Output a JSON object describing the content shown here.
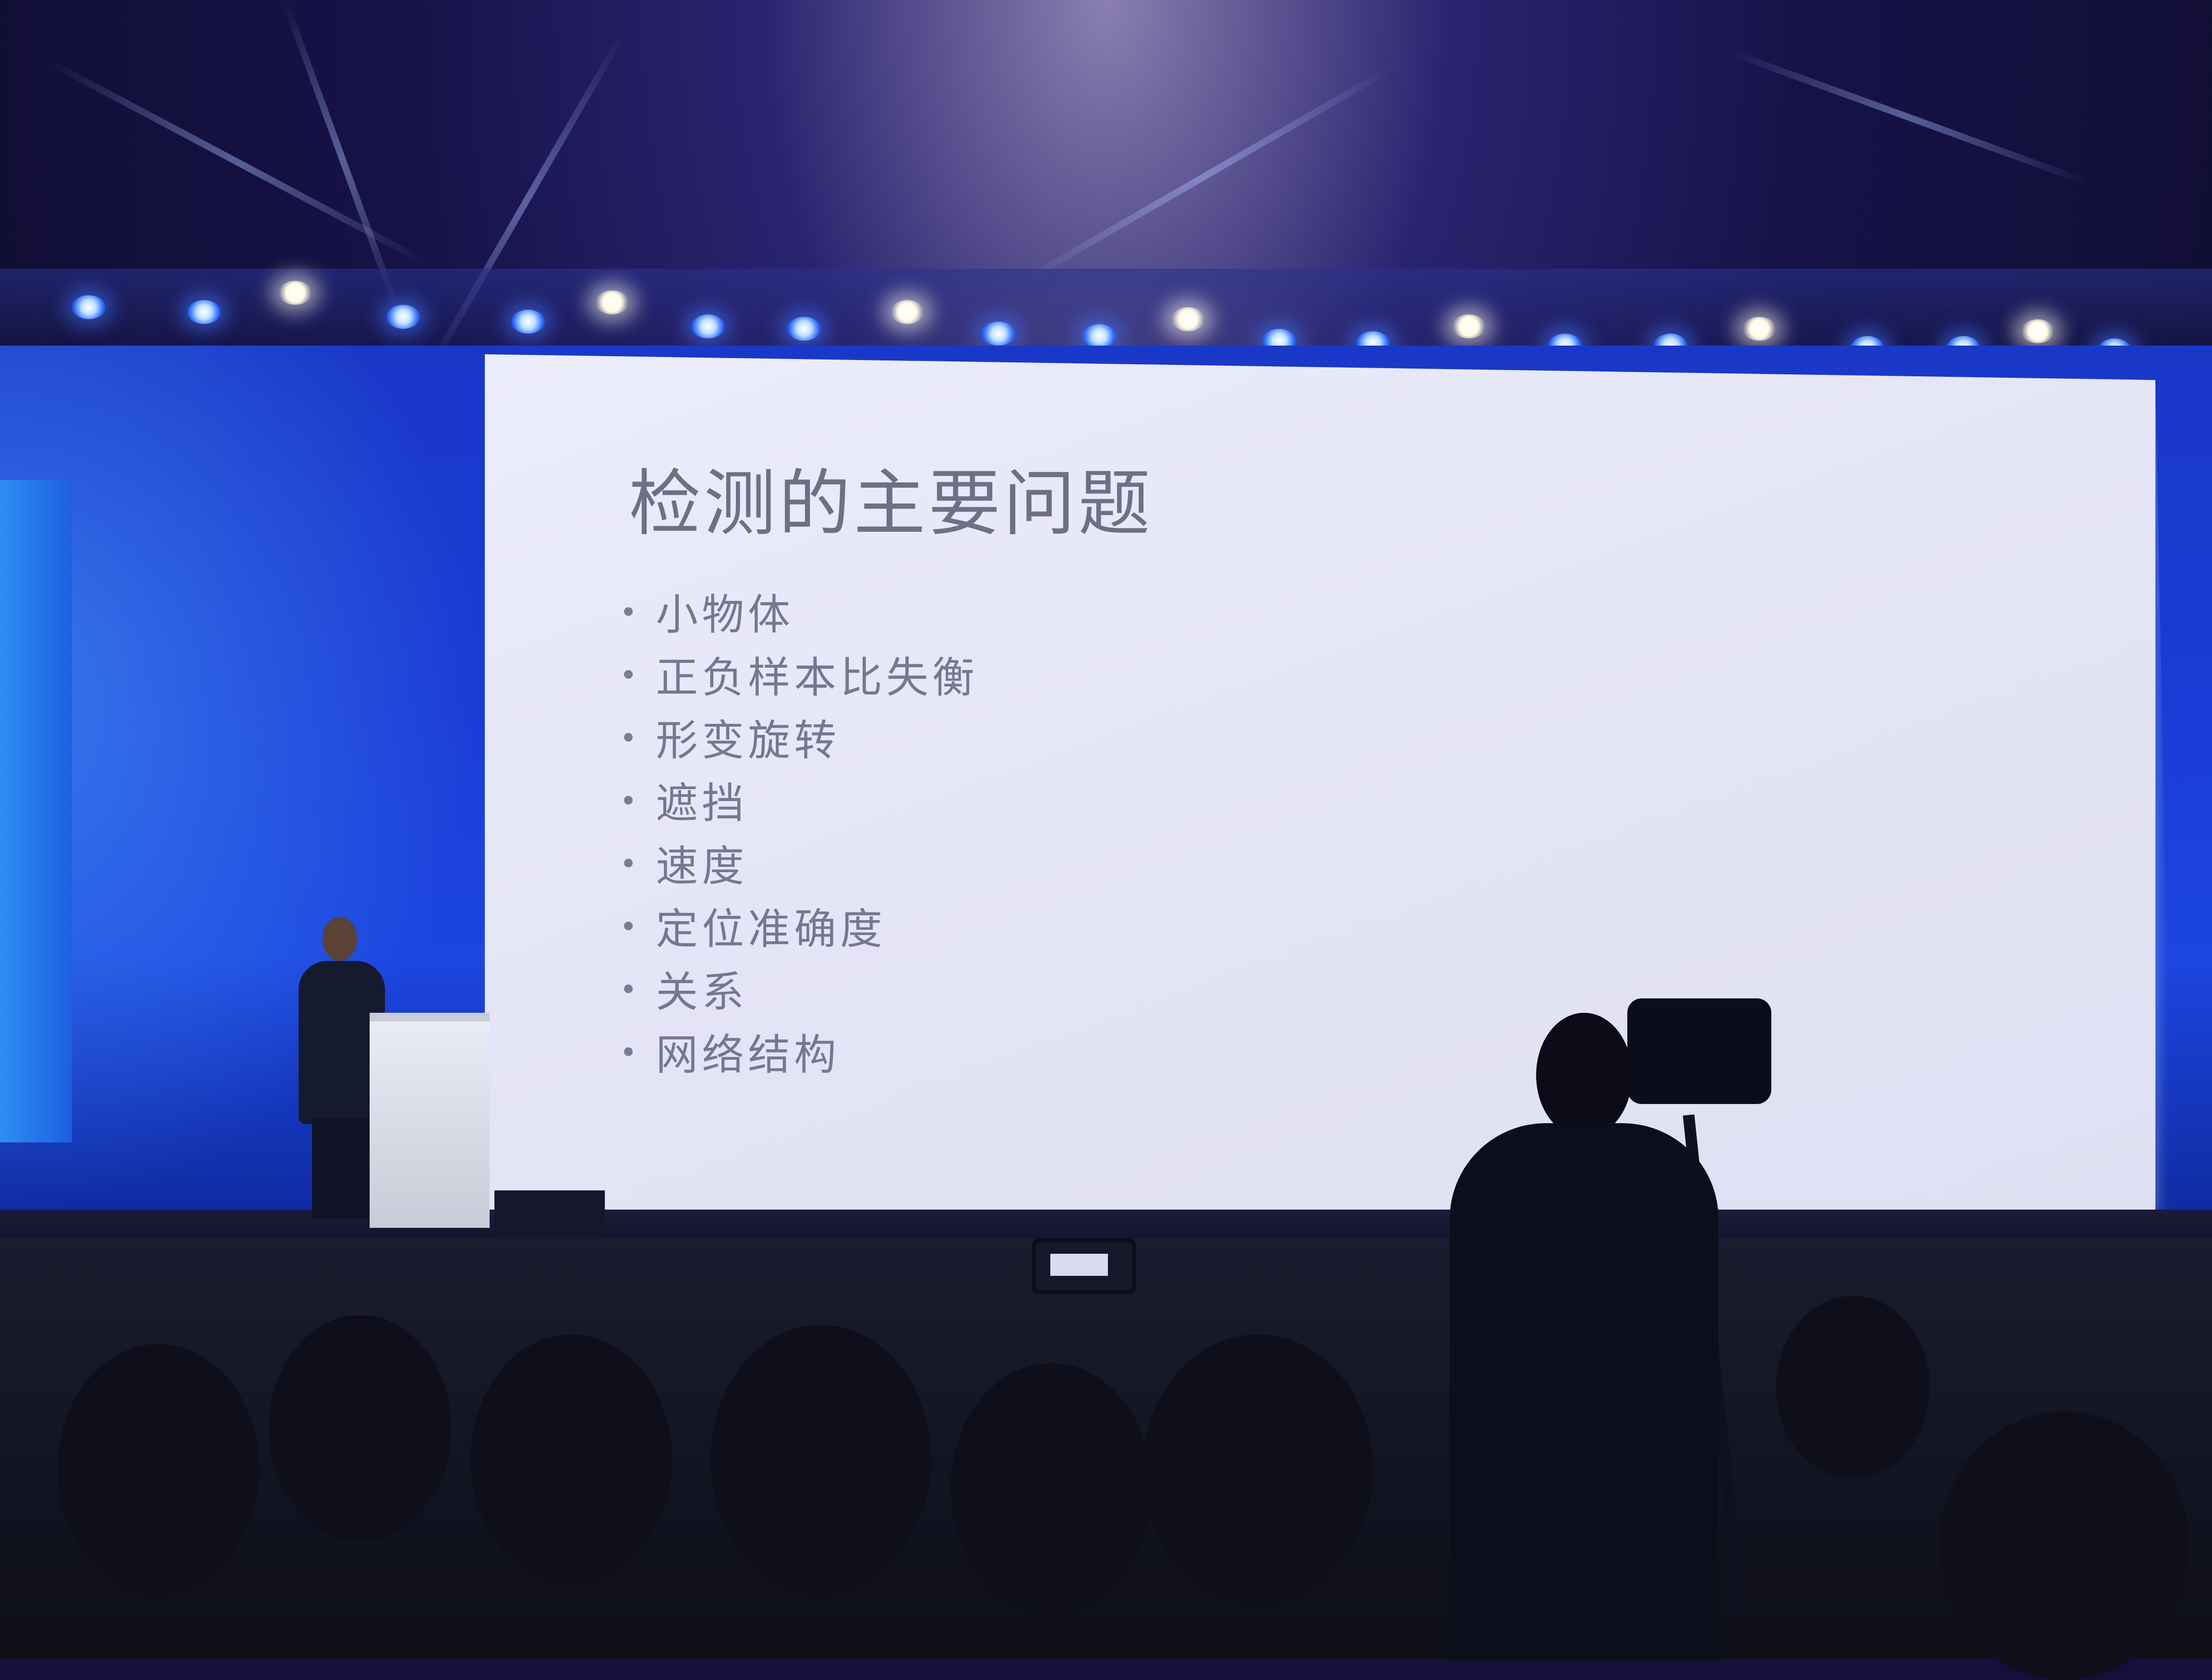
{
  "slide": {
    "title": "检测的主要问题",
    "items": [
      "小物体",
      "正负样本比失衡",
      "形变旋转",
      "遮挡",
      "速度",
      "定位准确度",
      "关系",
      "网络结构"
    ]
  },
  "scene": {
    "colors": {
      "led_wall": "#1b3bd6",
      "slide_background": "#e6e7f7",
      "slide_text": "#77778f",
      "stage_lights": "#2b6bff"
    }
  }
}
